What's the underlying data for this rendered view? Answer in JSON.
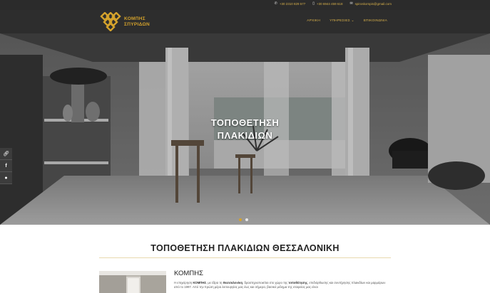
{
  "topbar": {
    "phone1": "+30 2310 829 577",
    "phone2": "+30 6944 459 618",
    "email": "spiroskompis@gmail.com"
  },
  "logo": {
    "line1": "ΚΟΜΠΗΣ",
    "line2": "ΣΠΥΡΙΔΩΝ"
  },
  "nav": {
    "home": "ΑΡΧΙΚΗ",
    "services": "ΥΠΗΡΕΣΙΕΣ ⌄",
    "contact": "ΕΠΙΚΟΙΝΩΝΙΑ"
  },
  "hero": {
    "title_line1": "ΤΟΠΟΘΕΤΗΣΗ",
    "title_line2": "ΠΛΑΚΙΔΙΩΝ",
    "slides_total": 2,
    "slide_active": 1
  },
  "main": {
    "section_title": "ΤΟΠΟΘΕΤΗΣΗ ΠΛΑΚΙΔΙΩΝ ΘΕΣΣΑΛΟΝΙΚΗ",
    "company_heading": "ΚΟΜΠΗΣ",
    "intro": {
      "p1": "Η επιχείρηση ",
      "b1": "ΚΟΜΠΗΣ",
      "p2": ", με έδρα τη ",
      "b2": "Θεσσαλονίκη",
      "p3": ", δραστηριοποιείται στο χώρο της ",
      "b3": "τοποθέτησης",
      "p4": ", επιδιόρθωσης και συντήρησης πλακιδίων και μαρμάρων από το 1997. Από την πρώτη μέρα λειτουργίας μας έως και σήμερα, βασικό μέλημα της εταιρείας μας είναι"
    }
  },
  "colors": {
    "gold": "#d4a22c",
    "dark": "#2d2d2d"
  },
  "icons": [
    "phone-icon",
    "mobile-icon",
    "email-icon",
    "link-icon",
    "facebook-icon",
    "messenger-icon"
  ]
}
